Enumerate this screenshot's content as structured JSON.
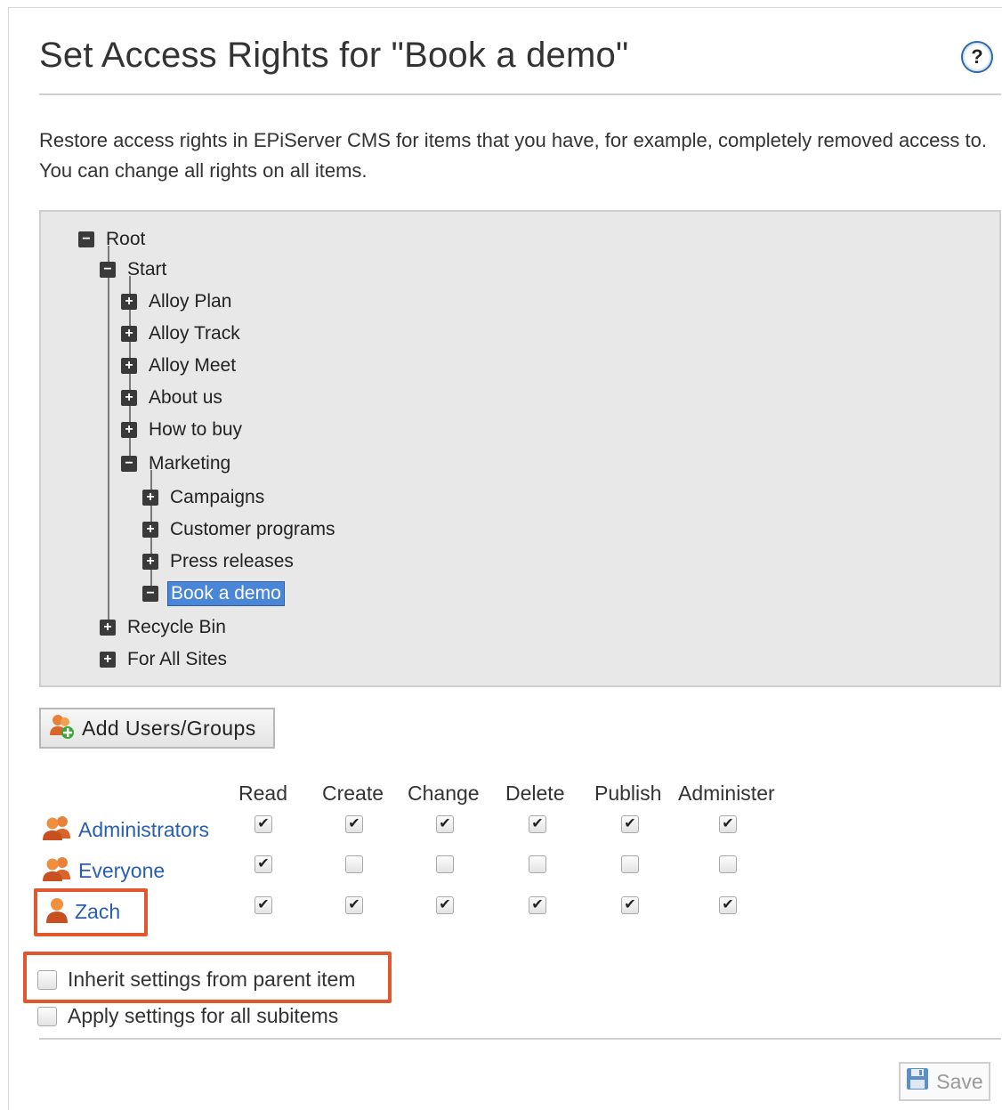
{
  "page": {
    "title": "Set Access Rights for \"Book a demo\"",
    "description": "Restore access rights in EPiServer CMS for items that you have, for example, completely removed access to. You can change all rights on all items.",
    "help_icon": "question-mark-icon"
  },
  "tree": {
    "nodes": [
      {
        "label": "Root",
        "state": "expanded"
      },
      {
        "label": "Start",
        "state": "expanded"
      },
      {
        "label": "Alloy Plan",
        "state": "collapsed"
      },
      {
        "label": "Alloy Track",
        "state": "collapsed"
      },
      {
        "label": "Alloy Meet",
        "state": "collapsed"
      },
      {
        "label": "About us",
        "state": "collapsed"
      },
      {
        "label": "How to buy",
        "state": "collapsed"
      },
      {
        "label": "Marketing",
        "state": "expanded"
      },
      {
        "label": "Campaigns",
        "state": "collapsed"
      },
      {
        "label": "Customer programs",
        "state": "collapsed"
      },
      {
        "label": "Press releases",
        "state": "collapsed"
      },
      {
        "label": "Book a demo",
        "state": "expanded",
        "selected": true
      },
      {
        "label": "Recycle Bin",
        "state": "collapsed"
      },
      {
        "label": "For All Sites",
        "state": "collapsed"
      }
    ]
  },
  "add_button": {
    "label": "Add Users/Groups",
    "icon": "add-users-icon"
  },
  "permissions": {
    "columns": [
      "Read",
      "Create",
      "Change",
      "Delete",
      "Publish",
      "Administer"
    ],
    "principals": [
      {
        "name": "Administrators",
        "type": "group",
        "rights": [
          true,
          true,
          true,
          true,
          true,
          true
        ]
      },
      {
        "name": "Everyone",
        "type": "group",
        "rights": [
          true,
          false,
          false,
          false,
          false,
          false
        ]
      },
      {
        "name": "Zach",
        "type": "user",
        "rights": [
          true,
          true,
          true,
          true,
          true,
          true
        ],
        "highlighted": true
      }
    ]
  },
  "options": {
    "inherit_label": "Inherit settings from parent item",
    "inherit_checked": false,
    "apply_label": "Apply settings for all subitems",
    "apply_checked": false
  },
  "save": {
    "label": "Save",
    "icon": "floppy-disk-icon",
    "disabled": true
  },
  "colors": {
    "accent_blue": "#2a5fb0",
    "highlight": "#e2582e",
    "selected_node": "#4a86d8"
  }
}
